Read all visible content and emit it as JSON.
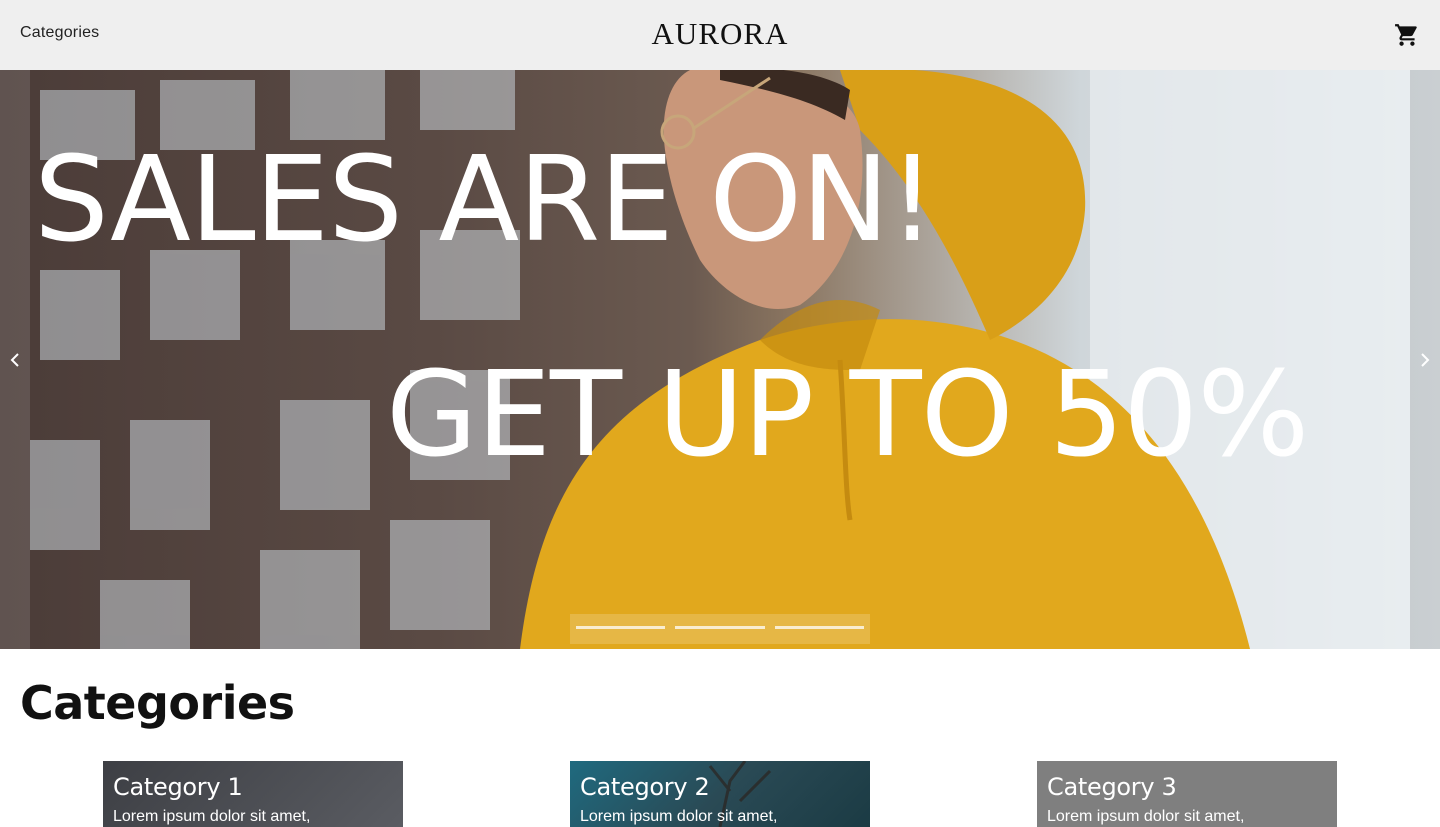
{
  "header": {
    "nav_categories": "Categories",
    "brand": "AURORA",
    "cart_icon": "shopping-cart-icon"
  },
  "hero": {
    "headline_1": "SALES ARE ON!",
    "headline_2": "GET UP TO 50%",
    "prev_icon": "chevron-left-icon",
    "next_icon": "chevron-right-icon",
    "slide_count": 3,
    "accent_color": "#e1a81d"
  },
  "categories": {
    "title": "Categories",
    "items": [
      {
        "title": "Category 1",
        "description": "Lorem ipsum dolor sit amet,"
      },
      {
        "title": "Category 2",
        "description": "Lorem ipsum dolor sit amet,"
      },
      {
        "title": "Category 3",
        "description": "Lorem ipsum dolor sit amet,"
      }
    ]
  }
}
